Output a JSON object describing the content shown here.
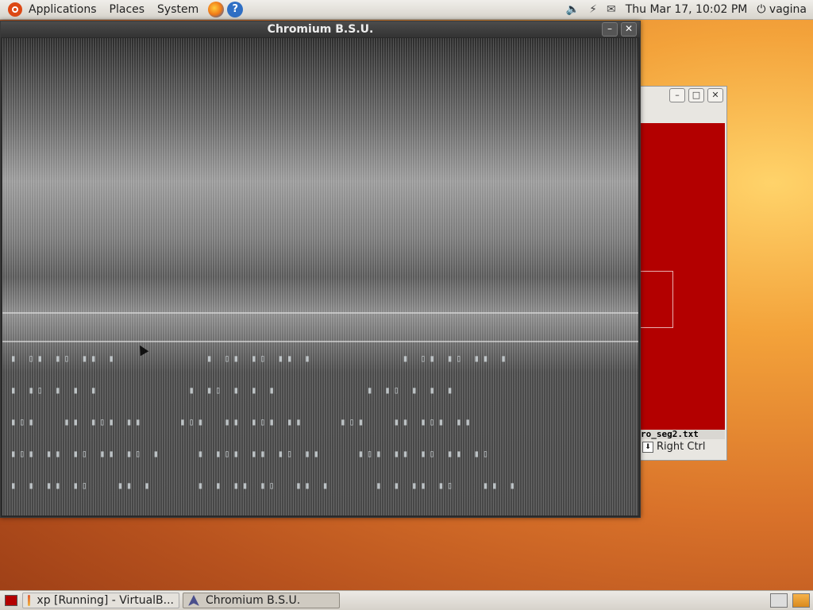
{
  "top_panel": {
    "menus": [
      "Applications",
      "Places",
      "System"
    ],
    "launchers": [
      "firefox-icon",
      "help-icon"
    ],
    "help_glyph": "?",
    "clock": "Thu Mar 17, 10:02 PM",
    "user": "vagina"
  },
  "main_window": {
    "title": "Chromium B.S.U.",
    "minimize": "–",
    "close": "✕"
  },
  "background_window": {
    "minimize": "–",
    "maximize": "□",
    "close": "✕",
    "filename": "ro_seg2.txt",
    "host_key": "Right Ctrl"
  },
  "taskbar": {
    "items": [
      {
        "label": "xp [Running] - VirtualB...",
        "icon": "virtualbox-icon"
      },
      {
        "label": "Chromium B.S.U.",
        "icon": "jet-icon"
      }
    ]
  },
  "colors": {
    "panel": "#e0ddd7",
    "red_area": "#b30000",
    "desktop_orange": "#d9722a"
  }
}
